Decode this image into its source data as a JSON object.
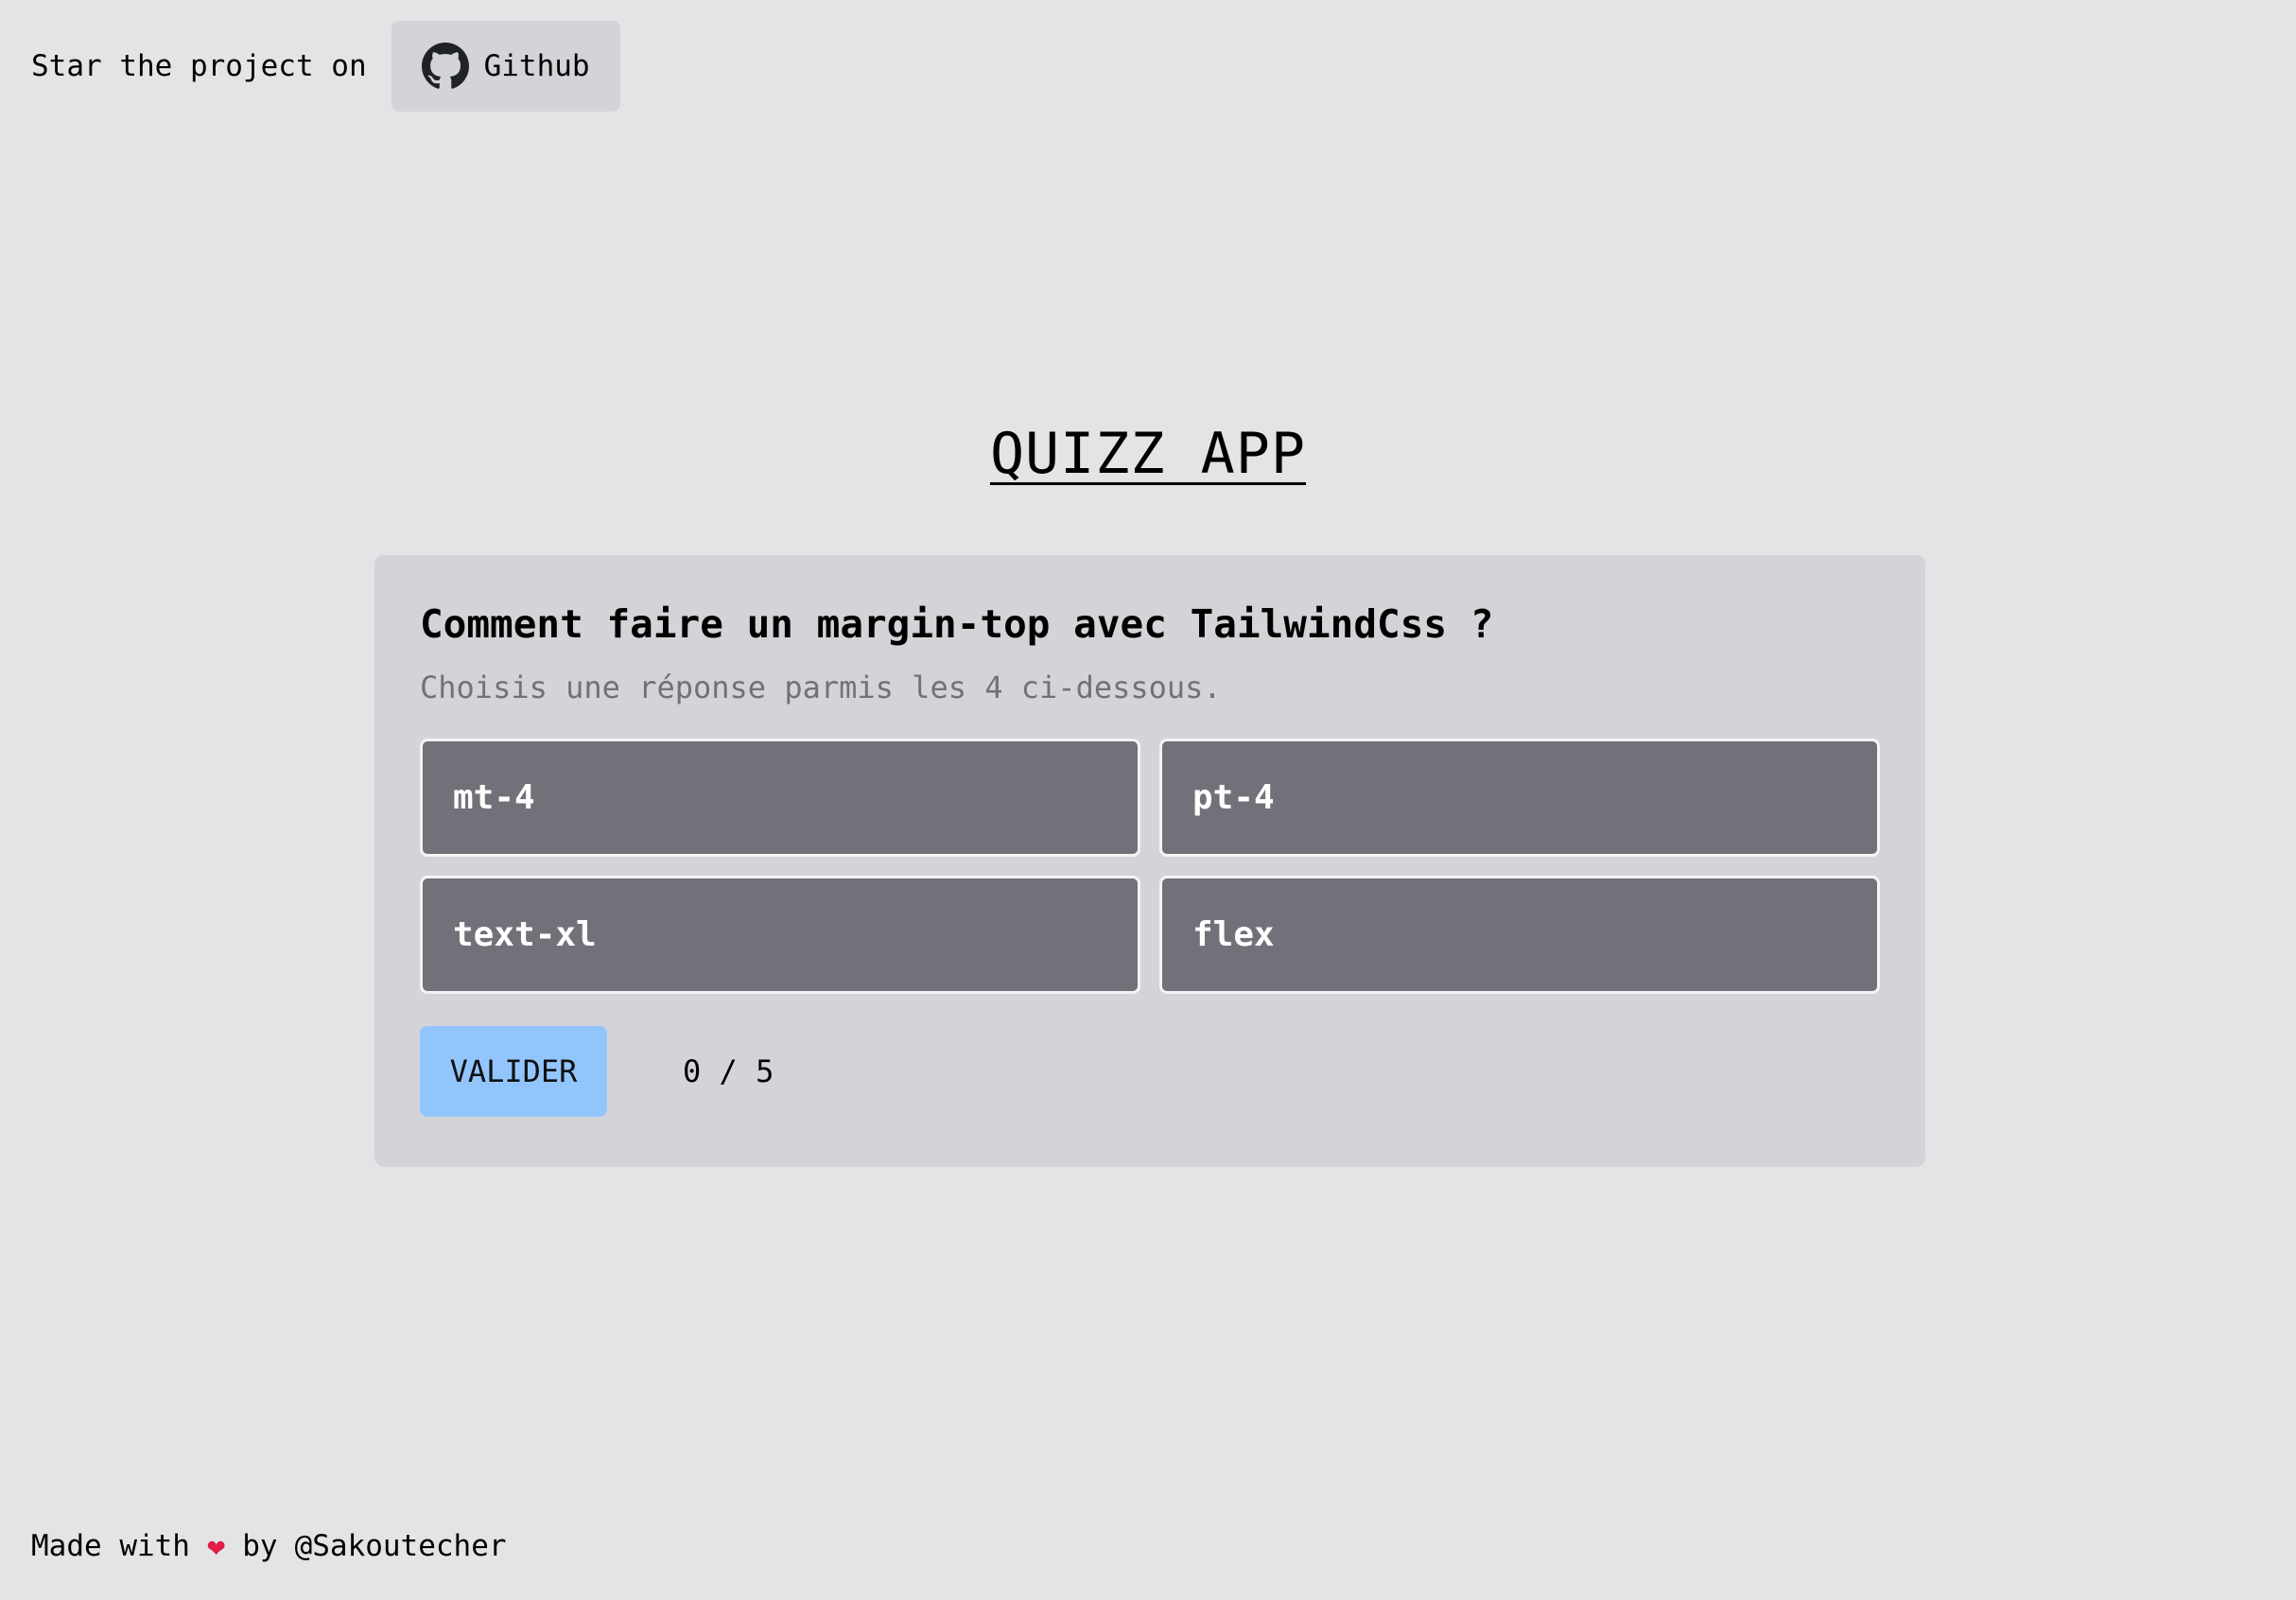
{
  "header": {
    "star_text": "Star the project on",
    "github_label": "Github"
  },
  "title": "QUIZZ APP",
  "quiz": {
    "question": "Comment faire un margin-top avec TailwindCss ?",
    "hint": "Choisis une réponse parmis les 4 ci-dessous.",
    "answers": [
      "mt-4",
      "pt-4",
      "text-xl",
      "flex"
    ],
    "validate_label": "VALIDER",
    "score": "0 / 5"
  },
  "footer": {
    "made_with": "Made with",
    "heart": "❤",
    "by": "by",
    "author": "@Sakoutecher"
  },
  "colors": {
    "background": "#e4e4e7",
    "card": "#d4d4d8",
    "answer": "#71717a",
    "validate": "#93c5fd",
    "heart": "#e11d48"
  },
  "icons": {
    "github": "github-icon",
    "heart": "heart-icon"
  }
}
